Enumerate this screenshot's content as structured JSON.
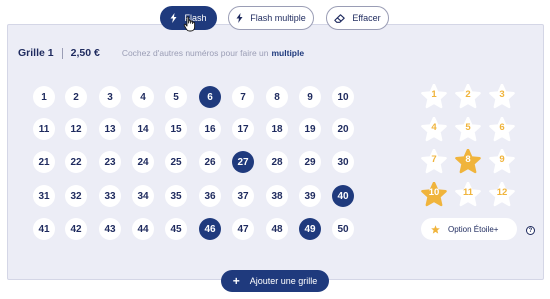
{
  "tabs": [
    {
      "label": "Flash",
      "icon": "lightning-icon",
      "active": true
    },
    {
      "label": "Flash multiple",
      "icon": "lightning-icon",
      "active": false
    },
    {
      "label": "Effacer",
      "icon": "eraser-icon",
      "active": false
    }
  ],
  "grid": {
    "name": "Grille 1",
    "price": "2,50 €",
    "hint": "Cochez d'autres numéros pour faire un",
    "hint_link": "multiple"
  },
  "numbers": [
    "1",
    "2",
    "3",
    "4",
    "5",
    "6",
    "7",
    "8",
    "9",
    "10",
    "11",
    "12",
    "13",
    "14",
    "15",
    "16",
    "17",
    "18",
    "19",
    "20",
    "21",
    "22",
    "23",
    "24",
    "25",
    "26",
    "27",
    "28",
    "29",
    "30",
    "31",
    "32",
    "33",
    "34",
    "35",
    "36",
    "37",
    "38",
    "39",
    "40",
    "41",
    "42",
    "43",
    "44",
    "45",
    "46",
    "47",
    "48",
    "49",
    "50"
  ],
  "selected_numbers": [
    "6",
    "27",
    "40",
    "46",
    "49"
  ],
  "stars": [
    "1",
    "2",
    "3",
    "4",
    "5",
    "6",
    "7",
    "8",
    "9",
    "10",
    "11",
    "12"
  ],
  "selected_stars": [
    "8",
    "10"
  ],
  "option_label": "Option Étoile+",
  "help_label": "?",
  "add_button": {
    "plus": "+",
    "label": "Ajouter une grille"
  },
  "colors": {
    "primary": "#1f3a7d",
    "star": "#f0b43c",
    "panel": "#ecedf6"
  }
}
